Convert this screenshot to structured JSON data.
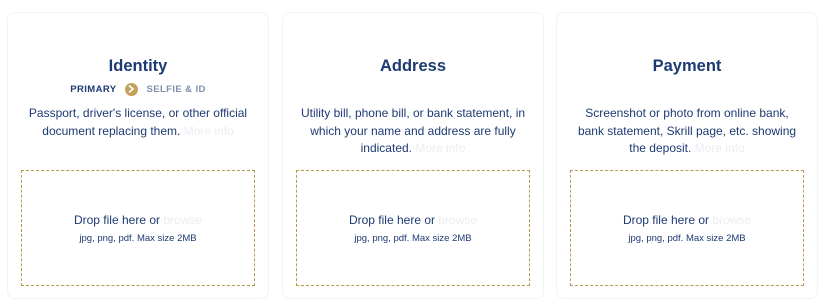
{
  "cards": [
    {
      "title": "Identity",
      "steps": {
        "primary": "PRIMARY",
        "secondary": "SELFIE & ID"
      },
      "description": "Passport, driver's license, or other official document replacing them.",
      "more_info": "More info",
      "dropzone": {
        "text": "Drop file here or",
        "browse": "browse",
        "hint": "jpg, png, pdf. Max size 2MB"
      }
    },
    {
      "title": "Address",
      "description": "Utility bill, phone bill, or bank statement, in which your name and address are fully indicated.",
      "more_info": "More info",
      "dropzone": {
        "text": "Drop file here or",
        "browse": "browse",
        "hint": "jpg, png, pdf. Max size 2MB"
      }
    },
    {
      "title": "Payment",
      "description": "Screenshot or photo from online bank, bank statement, Skrill page, etc. showing the deposit.",
      "more_info": "More info",
      "dropzone": {
        "text": "Drop file here or",
        "browse": "browse",
        "hint": "jpg, png, pdf. Max size 2MB"
      }
    }
  ],
  "colors": {
    "heading": "#1d3a73",
    "accent_gold": "#c4a158",
    "dashed_border": "#b89a4f",
    "muted_step": "#8090ad",
    "faded_link": "#ebedf1"
  },
  "icons": {
    "step_separator": "chevron-right-circle-icon"
  }
}
